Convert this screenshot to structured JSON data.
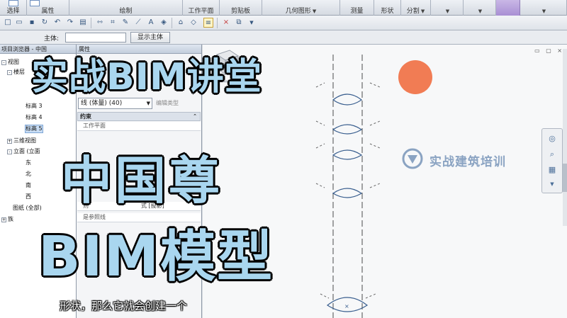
{
  "ribbon": {
    "select_label": "选择",
    "properties_label": "属性",
    "draw_label": "绘制",
    "workplane_label": "工作平面",
    "clipboard_label": "剪贴板",
    "geometry_label": "几何图形",
    "measure_label": "测量",
    "shape_label": "形状",
    "split_label": "分割"
  },
  "options_bar": {
    "host_label": "主体:",
    "show_host_label": "显示主体"
  },
  "browser": {
    "title": "项目浏览器 - 中国",
    "items": {
      "views": "视图",
      "floor_plans": "楼层",
      "level3": "标高 3",
      "level4": "标高 4",
      "level5": "标高 5",
      "views3d": "三维视图",
      "elevations": "立面 (立面",
      "east": "东",
      "north": "北",
      "south": "南",
      "west": "西",
      "sheets": "图纸 (全部)",
      "families": "族"
    }
  },
  "properties": {
    "title": "属性",
    "type_name": "线 (体量) (40)",
    "edit_type": "编辑类型",
    "group_constraints": "约束",
    "row_workplane": "工作平面",
    "row_rel": "则",
    "row_rel_value": "式 [投影]",
    "row_ref": "是参照线"
  },
  "canvas": {
    "brand": "实战建筑培训"
  },
  "overlay": {
    "line1": "实战BIM讲堂",
    "line2": "中国尊",
    "line3": "BIM模型",
    "subtitle": "形状，那么它就会创建一个"
  },
  "colors": {
    "overlay_fill": "#a9d6ef",
    "sun": "#f17c54",
    "brand": "#8aa3c2"
  },
  "icons": [
    "save-icon",
    "undo-icon",
    "redo-icon",
    "measure-icon",
    "text-icon",
    "close-icon",
    "viewcube-icon",
    "wheel-icon",
    "zoom-icon"
  ]
}
